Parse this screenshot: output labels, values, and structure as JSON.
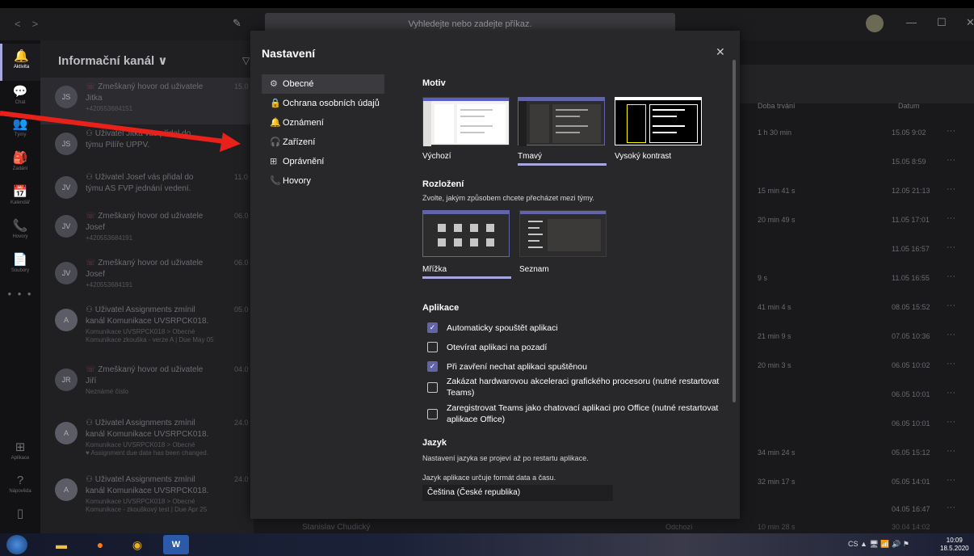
{
  "titlebar": {
    "nav_back": "<",
    "nav_forward": ">",
    "search_placeholder": "Vyhledejte nebo zadejte příkaz.",
    "minimize": "—",
    "maximize": "☐",
    "close": "✕"
  },
  "rail": {
    "items": [
      {
        "label": "Aktivita",
        "icon": "bell-icon",
        "glyph": "🔔"
      },
      {
        "label": "Chat",
        "icon": "chat-icon",
        "glyph": "💬"
      },
      {
        "label": "Týmy",
        "icon": "teams-icon",
        "glyph": "👥"
      },
      {
        "label": "Zadání",
        "icon": "assignments-icon",
        "glyph": "🎒"
      },
      {
        "label": "Kalendář",
        "icon": "calendar-icon",
        "glyph": "📅"
      },
      {
        "label": "Hovory",
        "icon": "phone-icon",
        "glyph": "📞"
      },
      {
        "label": "Soubory",
        "icon": "files-icon",
        "glyph": "📄"
      }
    ],
    "more": "• • •",
    "apps": {
      "label": "Aplikace",
      "glyph": "⊞"
    },
    "help": {
      "label": "Nápověda",
      "glyph": "?"
    },
    "device": {
      "glyph": "▯"
    }
  },
  "feed": {
    "title": "Informační kanál",
    "chevron": "∨",
    "filter": "▽",
    "items": [
      {
        "avatar": "JS",
        "line1": "Zmeškaný hovor od uživatele",
        "line2": "Jitka",
        "line3": "+420553684151",
        "line4": "",
        "time": "15.0"
      },
      {
        "avatar": "JS",
        "line1": "Uživatel Jitka vás přidal do",
        "line2": "týmu Pilíře ÚPPV.",
        "line3": "",
        "line4": "",
        "time": ""
      },
      {
        "avatar": "JV",
        "line1": "Uživatel Josef vás přidal do",
        "line2": "týmu AS FVP jednání vedení.",
        "line3": "",
        "line4": "",
        "time": "11.0"
      },
      {
        "avatar": "JV",
        "line1": "Zmeškaný hovor od uživatele",
        "line2": "Josef",
        "line3": "+420553684191",
        "line4": "",
        "time": "06.0"
      },
      {
        "avatar": "JV",
        "line1": "Zmeškaný hovor od uživatele",
        "line2": "Josef",
        "line3": "+420553684191",
        "line4": "",
        "time": "06.0"
      },
      {
        "avatar": "A",
        "line1": "Uživatel Assignments zmínil",
        "line2": "kanál Komunikace UVSRPCK018.",
        "line3": "Komunikace UVSRPCK018 > Obecné",
        "line4": "Komunikace zkouška - verze A | Due May 05",
        "time": "05.0"
      },
      {
        "avatar": "JR",
        "line1": "Zmeškaný hovor od uživatele",
        "line2": "Jiří",
        "line3": "Neznámé číslo",
        "line4": "",
        "time": "04.0"
      },
      {
        "avatar": "A",
        "line1": "Uživatel Assignments zmínil",
        "line2": "kanál Komunikace UVSRPCK018.",
        "line3": "Komunikace UVSRPCK018 > Obecné",
        "line4": "Assignment due date has been changed.",
        "time": "24.0"
      },
      {
        "avatar": "A",
        "line1": "Uživatel Assignments zmínil",
        "line2": "kanál Komunikace UVSRPCK018.",
        "line3": "Komunikace UVSRPCK018 > Obecné",
        "line4": "Komunikace - zkouškový test | Due Apr 25",
        "time": "24.0"
      }
    ]
  },
  "calls_table": {
    "col_duration": "Doba trvání",
    "col_date": "Datum",
    "more": "···",
    "rows": [
      {
        "duration": "1 h 30 min",
        "date": "15.05 9:02"
      },
      {
        "duration": "",
        "date": "15.05 8:59"
      },
      {
        "duration": "15 min 41 s",
        "date": "12.05 21:13"
      },
      {
        "duration": "20 min 49 s",
        "date": "11.05 17:01"
      },
      {
        "duration": "",
        "date": "11.05 16:57"
      },
      {
        "duration": "9 s",
        "date": "11.05 16:55"
      },
      {
        "duration": "41 min 4 s",
        "date": "08.05 15:52"
      },
      {
        "duration": "21 min 9 s",
        "date": "07.05 10:36"
      },
      {
        "duration": "20 min 3 s",
        "date": "06.05 10:02"
      },
      {
        "duration": "",
        "date": "06.05 10:01"
      },
      {
        "duration": "",
        "date": "06.05 10:01"
      },
      {
        "duration": "34 min 24 s",
        "date": "05.05 15:12"
      },
      {
        "duration": "32 min 17 s",
        "date": "05.05 14:01"
      },
      {
        "duration": "",
        "date": "04.05 16:47"
      }
    ],
    "bottom_name": "Stanislav Chudický",
    "bottom_action": "Odchozí",
    "bottom_duration": "10 min 28 s",
    "bottom_date": "30.04 14:02"
  },
  "modal": {
    "title": "Nastavení",
    "close": "✕",
    "nav": [
      {
        "label": "Obecné",
        "glyph": "⚙"
      },
      {
        "label": "Ochrana osobních údajů",
        "glyph": "🔒"
      },
      {
        "label": "Oznámení",
        "glyph": "🔔"
      },
      {
        "label": "Zařízení",
        "glyph": "🎧"
      },
      {
        "label": "Oprávnění",
        "glyph": "⊞"
      },
      {
        "label": "Hovory",
        "glyph": "📞"
      }
    ],
    "theme": {
      "heading": "Motiv",
      "options": [
        "Výchozí",
        "Tmavý",
        "Vysoký kontrast"
      ],
      "selected": "Tmavý"
    },
    "layout": {
      "heading": "Rozložení",
      "description": "Zvolte, jakým způsobem chcete přecházet mezi týmy.",
      "options": [
        "Mřížka",
        "Seznam"
      ],
      "selected": "Mřížka"
    },
    "apps": {
      "heading": "Aplikace",
      "options": [
        {
          "label": "Automaticky spouštět aplikaci",
          "checked": true
        },
        {
          "label": "Otevírat aplikaci na pozadí",
          "checked": false
        },
        {
          "label": "Při zavření nechat aplikaci spuštěnou",
          "checked": true
        },
        {
          "label": "Zakázat hardwarovou akceleraci grafického procesoru (nutné restartovat Teams)",
          "checked": false
        },
        {
          "label": "Zaregistrovat Teams jako chatovací aplikaci pro Office (nutné restartovat aplikace Office)",
          "checked": false
        }
      ]
    },
    "language": {
      "heading": "Jazyk",
      "note": "Nastavení jazyka se projeví až po restartu aplikace.",
      "format_note": "Jazyk aplikace určuje formát data a času.",
      "value": "Čeština (České republika)"
    }
  },
  "taskbar": {
    "tray_text": "CS  ▲  🖥  📶  🔊  ⚑",
    "time": "10:09",
    "date": "18.5.2020"
  },
  "colors": {
    "accent": "#6264a7",
    "accent_light": "#a6a7dc",
    "modal_bg": "#28282b",
    "arrow": "#e8211b"
  }
}
